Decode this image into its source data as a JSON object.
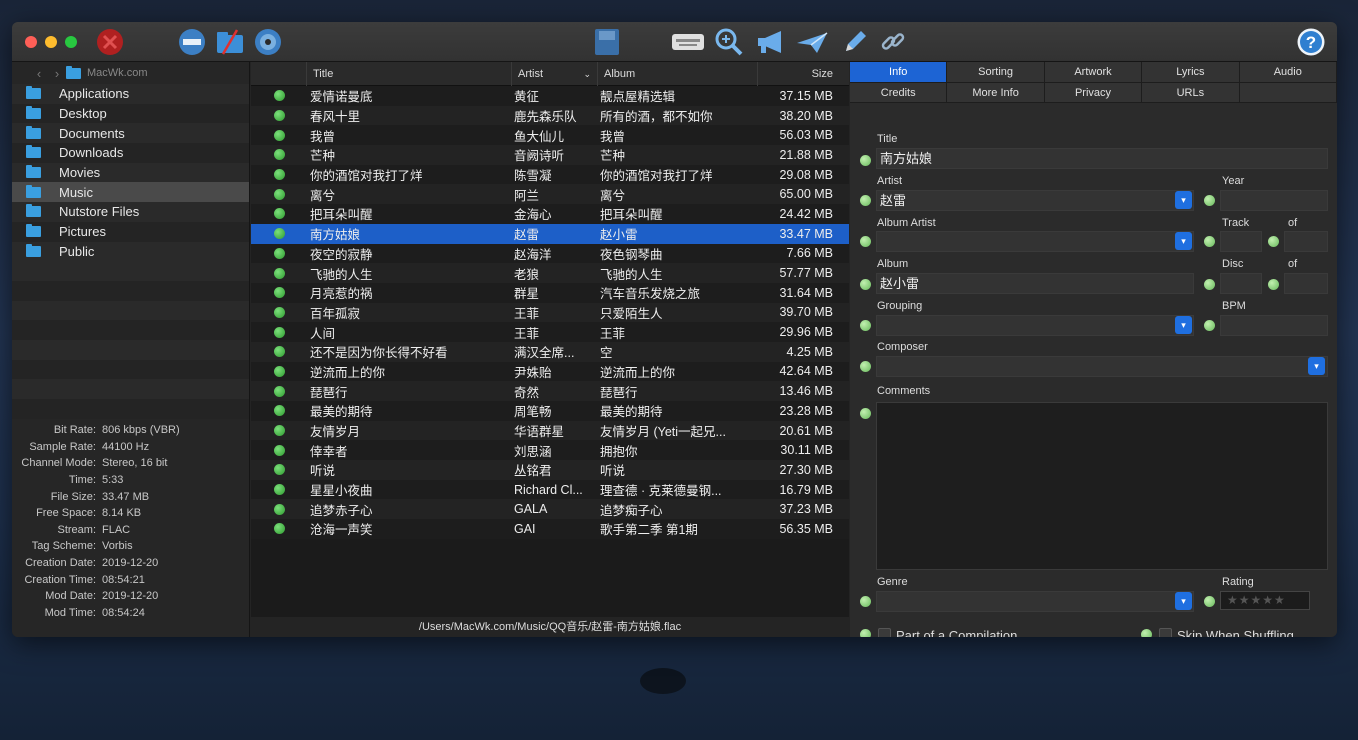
{
  "toolbar": {
    "icons": [
      "close-remove-icon",
      "minus-icon",
      "folder-icon",
      "disc-icon",
      "save-icon",
      "keyboard-icon",
      "zoom-icon",
      "megaphone-icon",
      "plane-icon",
      "pencil-icon",
      "link-icon",
      "help-icon"
    ],
    "help_label": "?"
  },
  "sidebar": {
    "path": "MacWk.com",
    "folders": [
      "Applications",
      "Desktop",
      "Documents",
      "Downloads",
      "Movies",
      "Music",
      "Nutstore Files",
      "Pictures",
      "Public"
    ],
    "properties": [
      {
        "k": "Bit Rate:",
        "v": "806 kbps (VBR)"
      },
      {
        "k": "Sample Rate:",
        "v": "44100 Hz"
      },
      {
        "k": "Channel Mode:",
        "v": "Stereo, 16 bit"
      },
      {
        "k": "Time:",
        "v": "5:33"
      },
      {
        "k": "File Size:",
        "v": "33.47 MB"
      },
      {
        "k": "Free Space:",
        "v": "8.14 KB"
      },
      {
        "k": "Stream:",
        "v": "FLAC"
      },
      {
        "k": "Tag Scheme:",
        "v": "Vorbis"
      },
      {
        "k": "Creation Date:",
        "v": "2019-12-20"
      },
      {
        "k": "Creation Time:",
        "v": "08:54:21"
      },
      {
        "k": "Mod Date:",
        "v": "2019-12-20"
      },
      {
        "k": "Mod Time:",
        "v": "08:54:24"
      }
    ]
  },
  "tracks": {
    "headers": {
      "title": "Title",
      "artist": "Artist",
      "album": "Album",
      "size": "Size"
    },
    "rows": [
      {
        "title": "爱情诺曼底",
        "artist": "黄征",
        "album": "靓点屋精选辑",
        "size": "37.15 MB"
      },
      {
        "title": "春风十里",
        "artist": "鹿先森乐队",
        "album": "所有的酒，都不如你",
        "size": "38.20 MB"
      },
      {
        "title": "我曾",
        "artist": "鱼大仙儿",
        "album": "我曾",
        "size": "56.03 MB"
      },
      {
        "title": "芒种",
        "artist": "音阙诗听",
        "album": "芒种",
        "size": "21.88 MB"
      },
      {
        "title": "你的酒馆对我打了烊",
        "artist": "陈雪凝",
        "album": "你的酒馆对我打了烊",
        "size": "29.08 MB"
      },
      {
        "title": "离兮",
        "artist": "阿兰",
        "album": "离兮",
        "size": "65.00 MB"
      },
      {
        "title": "把耳朵叫醒",
        "artist": "金海心",
        "album": "把耳朵叫醒",
        "size": "24.42 MB"
      },
      {
        "title": "南方姑娘",
        "artist": "赵雷",
        "album": "赵小雷",
        "size": "33.47 MB",
        "selected": true
      },
      {
        "title": "夜空的寂静",
        "artist": "赵海洋",
        "album": "夜色钢琴曲",
        "size": "7.66 MB"
      },
      {
        "title": "飞驰的人生",
        "artist": "老狼",
        "album": "飞驰的人生",
        "size": "57.77 MB"
      },
      {
        "title": "月亮惹的祸",
        "artist": "群星",
        "album": "汽车音乐发烧之旅",
        "size": "31.64 MB"
      },
      {
        "title": "百年孤寂",
        "artist": "王菲",
        "album": "只爱陌生人",
        "size": "39.70 MB"
      },
      {
        "title": "人间",
        "artist": "王菲",
        "album": "王菲",
        "size": "29.96 MB"
      },
      {
        "title": "还不是因为你长得不好看",
        "artist": "满汉全席...",
        "album": "空",
        "size": "4.25 MB"
      },
      {
        "title": "逆流而上的你",
        "artist": "尹姝贻",
        "album": "逆流而上的你",
        "size": "42.64 MB"
      },
      {
        "title": "琵琶行",
        "artist": "奇然",
        "album": "琵琶行",
        "size": "13.46 MB"
      },
      {
        "title": "最美的期待",
        "artist": "周笔畅",
        "album": "最美的期待",
        "size": "23.28 MB"
      },
      {
        "title": "友情岁月",
        "artist": "华语群星",
        "album": "友情岁月 (Yeti一起兄...",
        "size": "20.61 MB"
      },
      {
        "title": "倖幸者",
        "artist": "刘思涵",
        "album": "拥抱你",
        "size": "30.11 MB"
      },
      {
        "title": "听说",
        "artist": "丛铭君",
        "album": "听说",
        "size": "27.30 MB"
      },
      {
        "title": "星星小夜曲",
        "artist": "Richard Cl...",
        "album": "理查德 · 克莱德曼钢...",
        "size": "16.79 MB"
      },
      {
        "title": "追梦赤子心",
        "artist": "GALA",
        "album": "追梦痴子心",
        "size": "37.23 MB"
      },
      {
        "title": "沧海一声笑",
        "artist": "GAI",
        "album": "歌手第二季 第1期",
        "size": "56.35 MB"
      }
    ],
    "path": "/Users/MacWk.com/Music/QQ音乐/赵雷-南方姑娘.flac"
  },
  "panel": {
    "tabs_row1": [
      "Info",
      "Sorting",
      "Artwork",
      "Lyrics",
      "Audio"
    ],
    "tabs_row2": [
      "Credits",
      "More Info",
      "Privacy",
      "URLs",
      ""
    ],
    "labels": {
      "title": "Title",
      "artist": "Artist",
      "year": "Year",
      "album_artist": "Album Artist",
      "track": "Track",
      "of": "of",
      "album": "Album",
      "disc": "Disc",
      "grouping": "Grouping",
      "bpm": "BPM",
      "composer": "Composer",
      "comments": "Comments",
      "genre": "Genre",
      "rating": "Rating",
      "compilation": "Part of a Compilation",
      "skip": "Skip When Shuffling"
    },
    "values": {
      "title": "南方姑娘",
      "artist": "赵雷",
      "album": "赵小雷"
    },
    "rating_stars": "★★★★★"
  },
  "colors": {
    "accent": "#1d64d4",
    "selection": "#1d5fc8",
    "folder": "#3a9fe0",
    "dot_green": "#3fb83f"
  }
}
